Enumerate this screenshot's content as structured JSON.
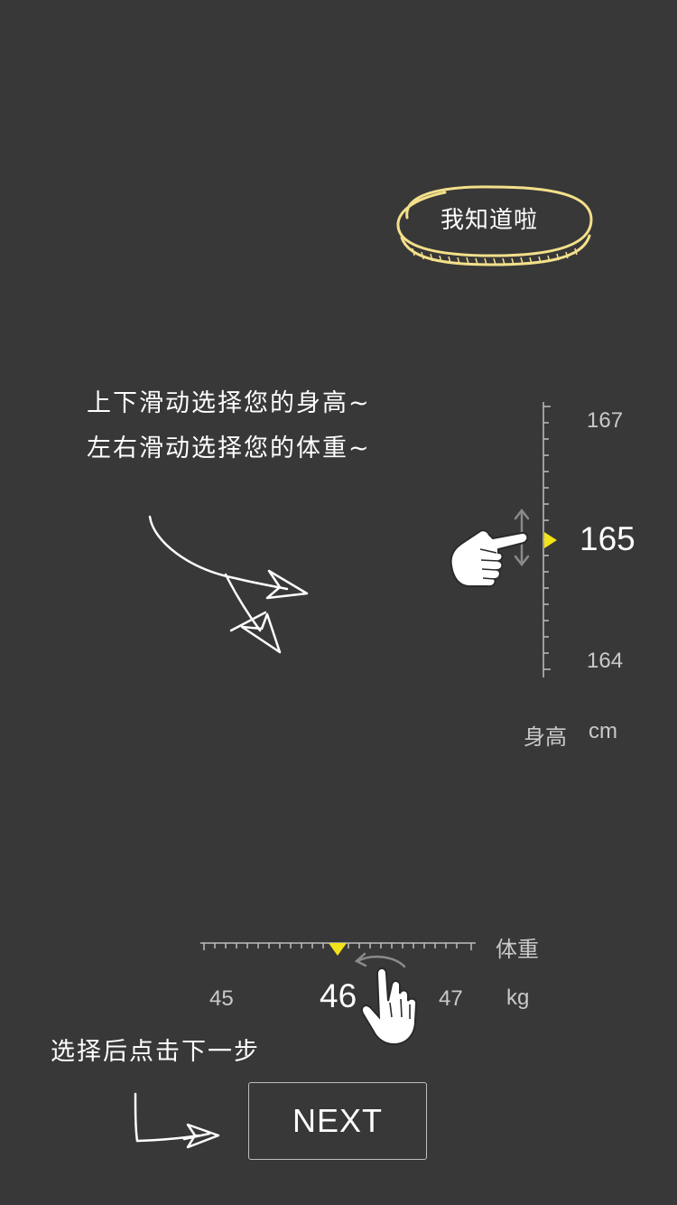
{
  "dismiss_button": {
    "label": "我知道啦"
  },
  "instructions": {
    "line1": "上下滑动选择您的身高~",
    "line2": "左右滑动选择您的体重~",
    "line3": "选择后点击下一步"
  },
  "height_picker": {
    "upper_value": "167",
    "current_value": "165",
    "lower_value": "164",
    "label": "身高",
    "unit": "cm"
  },
  "weight_picker": {
    "label": "体重",
    "left_value": "45",
    "current_value": "46",
    "right_value": "47",
    "unit": "kg"
  },
  "next_button": {
    "label": "NEXT"
  },
  "colors": {
    "background": "#383838",
    "accent_yellow": "#f2e21a",
    "pill_outline": "#f3e08a"
  },
  "icons": {
    "swipe_vertical_hand": "hand-pointer-icon",
    "swipe_horizontal_hand": "hand-pointer-icon",
    "curved_arrow": "curved-arrow-icon",
    "return_arrow": "return-arrow-icon"
  }
}
